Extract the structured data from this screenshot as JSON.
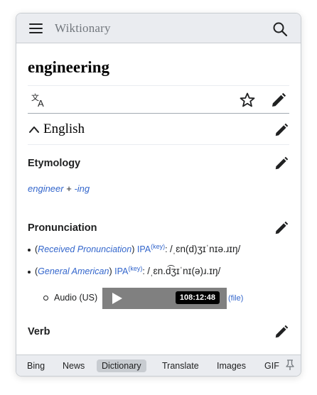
{
  "header": {
    "site_title": "Wiktionary",
    "menu_icon": "hamburger-menu-icon",
    "search_icon": "search-icon"
  },
  "page": {
    "title": "engineering"
  },
  "actions": {
    "translate_icon": "language-translate-icon",
    "watch_icon": "star-icon",
    "edit_icon": "pencil-edit-icon"
  },
  "language": {
    "name": "English",
    "collapse_icon": "chevron-up-icon"
  },
  "etymology": {
    "title": "Etymology",
    "word1": "engineer",
    "plus": " + ",
    "word2": "-ing"
  },
  "pronunciation": {
    "title": "Pronunciation",
    "lines": [
      {
        "open": "(",
        "accent": "Received Pronunciation",
        "close": ") ",
        "ipa_link": "IPA",
        "key": "(key)",
        "colon": ": ",
        "ipa": "/ˌɛn(d)ʒɪˈnɪə.ɹɪŋ/"
      },
      {
        "open": "(",
        "accent": "General American",
        "close": ") ",
        "ipa_link": "IPA",
        "key": "(key)",
        "colon": ": ",
        "ipa": "/ˌɛn.d͡ʒɪˈnɪ(ə)ɹ.ɪŋ/"
      }
    ],
    "audio": {
      "label": "Audio (US)",
      "duration": "108:12:48",
      "file_link": "(file)"
    }
  },
  "verb": {
    "title": "Verb"
  },
  "bottom_tabs": [
    {
      "label": "Bing",
      "active": false
    },
    {
      "label": "News",
      "active": false
    },
    {
      "label": "Dictionary",
      "active": true
    },
    {
      "label": "Translate",
      "active": false
    },
    {
      "label": "Images",
      "active": false
    },
    {
      "label": "GIF",
      "active": false
    }
  ],
  "colors": {
    "link": "#3366cc",
    "header_bg": "#eaecf0",
    "player_bg": "#808080"
  }
}
